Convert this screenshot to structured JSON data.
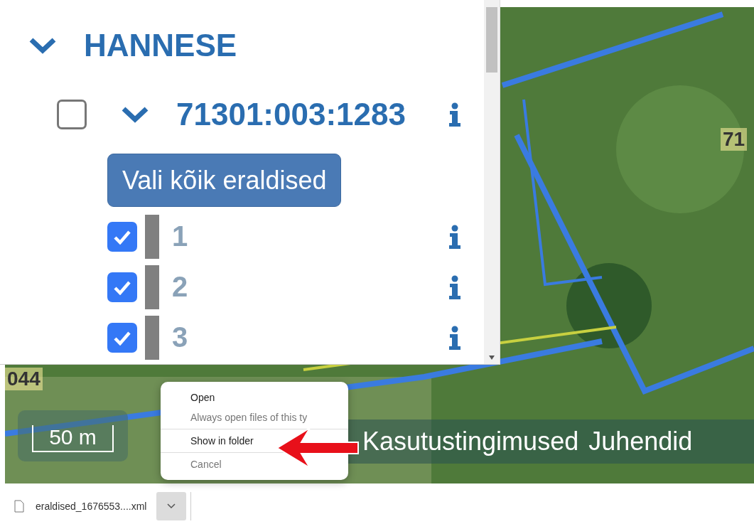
{
  "tree": {
    "title": "HANNESE",
    "expanded": true,
    "parcels": [
      {
        "label": "71301:003:1283",
        "checked": false,
        "expanded": true,
        "select_all_button": "Vali kõik eraldised",
        "children": [
          {
            "label": "1",
            "checked": true
          },
          {
            "label": "2",
            "checked": true
          },
          {
            "label": "3",
            "checked": true
          }
        ]
      }
    ]
  },
  "map": {
    "labels": [
      "044",
      "71"
    ],
    "scale": "50 m",
    "footer_links": [
      "Kasutustingimused",
      "Juhendid"
    ]
  },
  "context_menu": {
    "groups": [
      [
        {
          "label": "Open",
          "disabled": false
        },
        {
          "label": "Always open files of this ty",
          "disabled": true
        }
      ],
      [
        {
          "label": "Show in folder",
          "disabled": false
        }
      ],
      [
        {
          "label": "Cancel",
          "disabled": true
        }
      ]
    ]
  },
  "download_bar": {
    "file_name": "eraldised_1676553....xml"
  }
}
